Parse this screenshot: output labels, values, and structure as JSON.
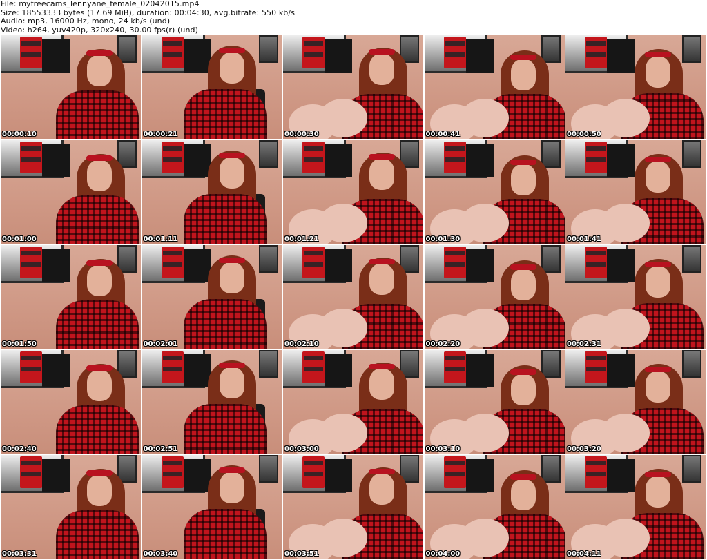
{
  "header": {
    "file_line": "File: myfreecams_lennyane_female_02042015.mp4",
    "size_line": "Size: 18553333 bytes (17.69 MiB), duration: 00:04:30, avg.bitrate: 550 kb/s",
    "audio_line": "Audio: mp3, 16000 Hz, mono, 24 kb/s (und)",
    "video_line": "Video: h264, yuv420p, 320x240, 30.00 fps(r) (und)"
  },
  "thumbnails": [
    {
      "timestamp": "00:00:10"
    },
    {
      "timestamp": "00:00:21"
    },
    {
      "timestamp": "00:00:30"
    },
    {
      "timestamp": "00:00:41"
    },
    {
      "timestamp": "00:00:50"
    },
    {
      "timestamp": "00:01:00"
    },
    {
      "timestamp": "00:01:11"
    },
    {
      "timestamp": "00:01:21"
    },
    {
      "timestamp": "00:01:30"
    },
    {
      "timestamp": "00:01:41"
    },
    {
      "timestamp": "00:01:50"
    },
    {
      "timestamp": "00:02:01"
    },
    {
      "timestamp": "00:02:10"
    },
    {
      "timestamp": "00:02:20"
    },
    {
      "timestamp": "00:02:31"
    },
    {
      "timestamp": "00:02:40"
    },
    {
      "timestamp": "00:02:51"
    },
    {
      "timestamp": "00:03:00"
    },
    {
      "timestamp": "00:03:10"
    },
    {
      "timestamp": "00:03:20"
    },
    {
      "timestamp": "00:03:31"
    },
    {
      "timestamp": "00:03:40"
    },
    {
      "timestamp": "00:03:51"
    },
    {
      "timestamp": "00:04:00"
    },
    {
      "timestamp": "00:04:11"
    }
  ]
}
